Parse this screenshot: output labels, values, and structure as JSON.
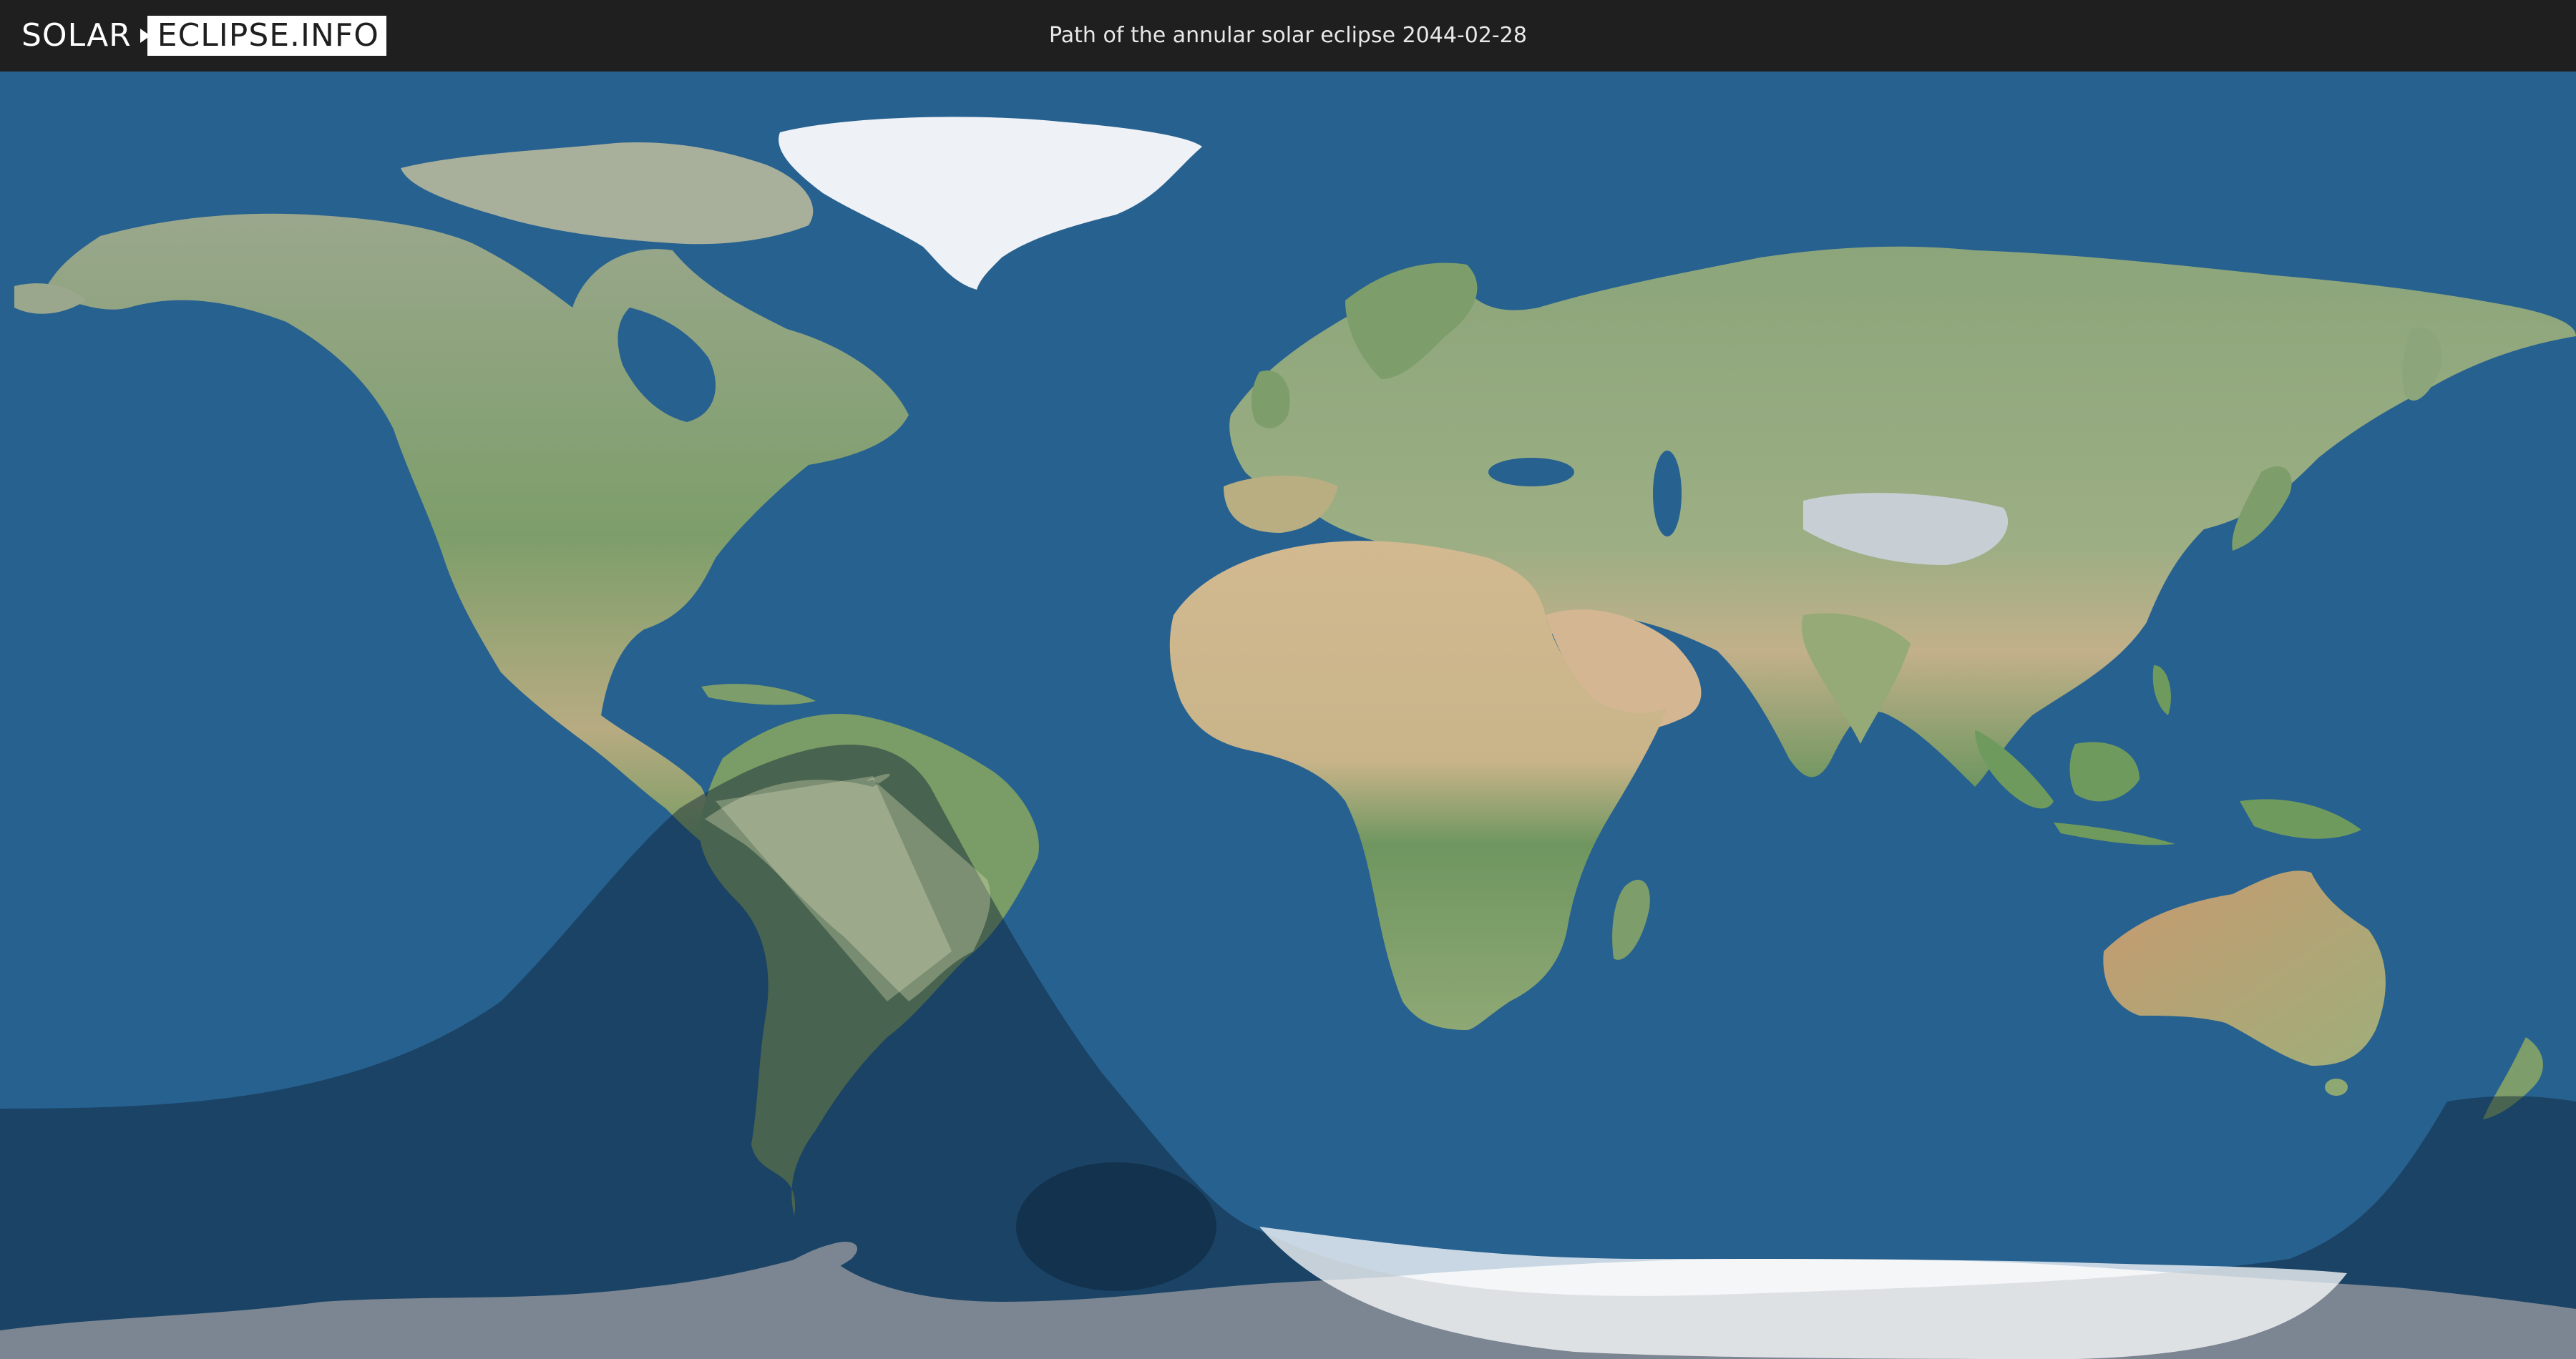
{
  "header": {
    "logo_part1": "SOLAR",
    "logo_part2": "ECLIPSE.INFO",
    "title": "Path of the annular solar eclipse 2044-02-28"
  },
  "map": {
    "colors": {
      "ocean": "#27618f",
      "land_green": "#7d9e6a",
      "land_desert": "#c9b48a",
      "ice": "#f2f4f8",
      "antarctic_ice": "#d7dbe0",
      "penumbra_shade": "#0c1f33",
      "annular_path": "#d9d2a0"
    }
  }
}
